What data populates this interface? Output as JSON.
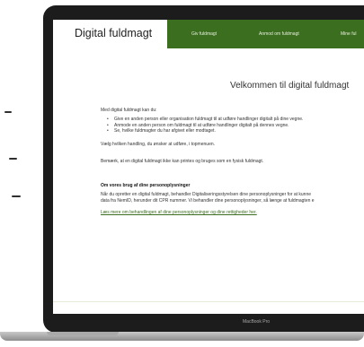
{
  "brand": "Digital fuldmagt",
  "nav": [
    "Giv fuldmagt",
    "Anmod om fuldmagt",
    "Mine ful"
  ],
  "page_title": "Velkommen til digital fuldmagt",
  "intro": "Med digital fuldmagt kan du:",
  "bullets": [
    "Give en anden person eller organisation fuldmagt til at udføre handlinger digitalt på dine vegne.",
    "Anmode en anden person om fuldmagt til at udføre handlinger digitalt på dennes vegne.",
    "Se, hvilke fuldmagter du har afgivet eller modtaget."
  ],
  "choose": "Vælg hvilken handling, du ønsker at udføre, i topmenuen.",
  "note": "Bemærk, at en digital fuldmagt ikke kan printes og bruges som en fysisk fuldmagt.",
  "data_heading": "Om vores brug af dine personoplysninger",
  "data_line1": "Når du opretter en digital fuldmagt, behandler Digitaliseringsstyrelsen dine personoplysninger for at kunne",
  "data_line2": "data fra NemID, herunder dit CPR nummer. Vi behandler dine personoplysninger, så længe at fuldmagten e",
  "link": "Læs mere om behandlingen af dine personoplysninger og dine rettigheder her.",
  "device_label": "MacBook Pro"
}
